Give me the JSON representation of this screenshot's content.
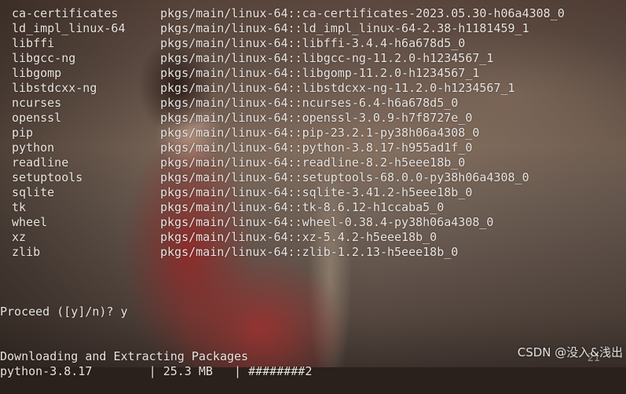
{
  "packages": [
    {
      "name": "ca-certificates",
      "source": "pkgs/main/linux-64::ca-certificates-2023.05.30-h06a4308_0"
    },
    {
      "name": "ld_impl_linux-64",
      "source": "pkgs/main/linux-64::ld_impl_linux-64-2.38-h1181459_1"
    },
    {
      "name": "libffi",
      "source": "pkgs/main/linux-64::libffi-3.4.4-h6a678d5_0"
    },
    {
      "name": "libgcc-ng",
      "source": "pkgs/main/linux-64::libgcc-ng-11.2.0-h1234567_1"
    },
    {
      "name": "libgomp",
      "source": "pkgs/main/linux-64::libgomp-11.2.0-h1234567_1"
    },
    {
      "name": "libstdcxx-ng",
      "source": "pkgs/main/linux-64::libstdcxx-ng-11.2.0-h1234567_1"
    },
    {
      "name": "ncurses",
      "source": "pkgs/main/linux-64::ncurses-6.4-h6a678d5_0"
    },
    {
      "name": "openssl",
      "source": "pkgs/main/linux-64::openssl-3.0.9-h7f8727e_0"
    },
    {
      "name": "pip",
      "source": "pkgs/main/linux-64::pip-23.2.1-py38h06a4308_0"
    },
    {
      "name": "python",
      "source": "pkgs/main/linux-64::python-3.8.17-h955ad1f_0"
    },
    {
      "name": "readline",
      "source": "pkgs/main/linux-64::readline-8.2-h5eee18b_0"
    },
    {
      "name": "setuptools",
      "source": "pkgs/main/linux-64::setuptools-68.0.0-py38h06a4308_0"
    },
    {
      "name": "sqlite",
      "source": "pkgs/main/linux-64::sqlite-3.41.2-h5eee18b_0"
    },
    {
      "name": "tk",
      "source": "pkgs/main/linux-64::tk-8.6.12-h1ccaba5_0"
    },
    {
      "name": "wheel",
      "source": "pkgs/main/linux-64::wheel-0.38.4-py38h06a4308_0"
    },
    {
      "name": "xz",
      "source": "pkgs/main/linux-64::xz-5.4.2-h5eee18b_0"
    },
    {
      "name": "zlib",
      "source": "pkgs/main/linux-64::zlib-1.2.13-h5eee18b_0"
    }
  ],
  "prompt": "Proceed ([y]/n)? y",
  "downloading_header": "Downloading and Extracting Packages",
  "progress_line": "python-3.8.17        | 25.3 MB   | ########2",
  "progress_percent": "21",
  "watermark": "CSDN @没入&浅出"
}
